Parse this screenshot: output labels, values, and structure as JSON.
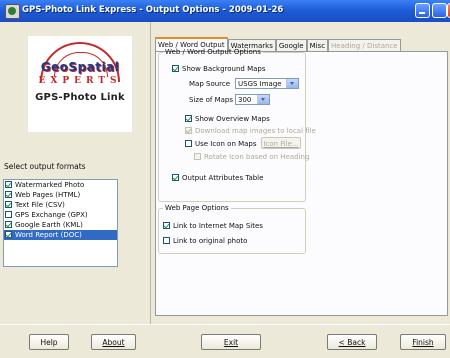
{
  "window": {
    "title": "GPS-Photo Link Express - Output Options - 2009-01-26"
  },
  "logo": {
    "line1": "GeoSpatial",
    "line2": "EXPERTS",
    "line3": "GPS-Photo Link"
  },
  "left": {
    "select_label": "Select output formats",
    "formats": [
      {
        "label": "Watermarked Photo",
        "checked": true
      },
      {
        "label": "Web Pages (HTML)",
        "checked": true
      },
      {
        "label": "Text File (CSV)",
        "checked": true
      },
      {
        "label": "GPS Exchange (GPX)",
        "checked": false
      },
      {
        "label": "Google Earth (KML)",
        "checked": true
      },
      {
        "label": "Word Report (DOC)",
        "checked": true,
        "selected": true
      }
    ]
  },
  "tabs": [
    {
      "label": "Web / Word Output",
      "active": true
    },
    {
      "label": "Watermarks"
    },
    {
      "label": "Google"
    },
    {
      "label": "Misc"
    },
    {
      "label": "Heading / Distance",
      "disabled": true
    }
  ],
  "output_options": {
    "legend": "Web / Word Output Options",
    "show_bg_maps": "Show Background Maps",
    "map_source_label": "Map Source",
    "map_source_value": "USGS Image",
    "size_label": "Size of Maps",
    "size_value": "300",
    "show_overview": "Show Overview Maps",
    "download_local": "Download map images to local file",
    "use_icon": "Use Icon on Maps",
    "icon_file_button": "Icon File...",
    "rotate_icon": "Rotate Icon based on Heading",
    "attributes_table": "Output Attributes Table"
  },
  "web_page_options": {
    "legend": "Web Page Options",
    "link_internet": "Link to Internet Map Sites",
    "link_original": "Link to original photo"
  },
  "buttons": {
    "help": "Help",
    "about": "About",
    "exit": "Exit",
    "back": "< Back",
    "finish": "Finish"
  }
}
